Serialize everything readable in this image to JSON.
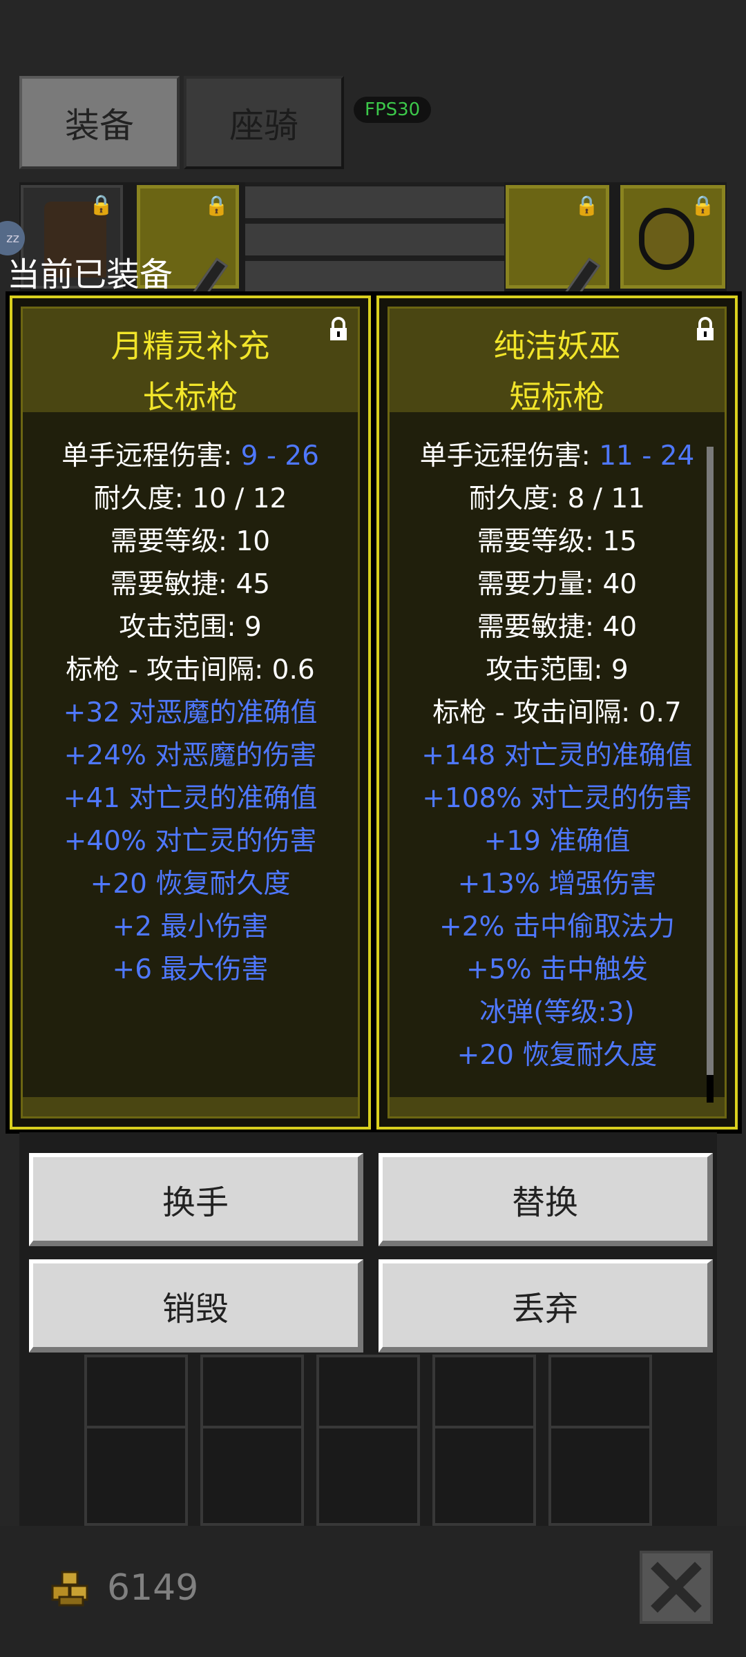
{
  "tabs": {
    "equipment": "装备",
    "mount": "座骑"
  },
  "fps": "FPS30",
  "equipped_label": "当前已装备",
  "panels": [
    {
      "name_line1": "月精灵补充",
      "name_line2": "长标枪",
      "stats": [
        {
          "label": "单手远程伤害: ",
          "value": "9 - 26"
        },
        {
          "text": "耐久度: 10 / 12"
        },
        {
          "text": "需要等级: 10"
        },
        {
          "text": "需要敏捷: 45"
        },
        {
          "text": "攻击范围: 9"
        },
        {
          "text": "标枪 - 攻击间隔: 0.6"
        }
      ],
      "mods": [
        "+32 对恶魔的准确值",
        "+24% 对恶魔的伤害",
        "+41 对亡灵的准确值",
        "+40% 对亡灵的伤害",
        "+20 恢复耐久度",
        "+2 最小伤害",
        "+6 最大伤害"
      ]
    },
    {
      "name_line1": "纯洁妖巫",
      "name_line2": "短标枪",
      "stats": [
        {
          "label": "单手远程伤害: ",
          "value": "11 - 24"
        },
        {
          "text": "耐久度: 8 / 11"
        },
        {
          "text": "需要等级: 15"
        },
        {
          "text": "需要力量: 40"
        },
        {
          "text": "需要敏捷: 40"
        },
        {
          "text": "攻击范围: 9"
        },
        {
          "text": "标枪 - 攻击间隔: 0.7"
        }
      ],
      "mods": [
        "+148 对亡灵的准确值",
        "+108% 对亡灵的伤害",
        "+19 准确值",
        "+13% 增强伤害",
        "+2% 击中偷取法力",
        "+5% 击中触发",
        "冰弹(等级:3)",
        "+20 恢复耐久度"
      ]
    }
  ],
  "buttons": {
    "swap_hand": "换手",
    "replace": "替换",
    "destroy": "销毁",
    "discard": "丢弃"
  },
  "gold": "6149",
  "colors": {
    "item_name": "#f2e52a",
    "mod_text": "#4f78ff",
    "panel_border": "#d9d01e",
    "fps": "#3cc84a"
  },
  "icons": [
    "lock-icon",
    "gold-coins-icon",
    "close-icon",
    "sleep-icon"
  ]
}
